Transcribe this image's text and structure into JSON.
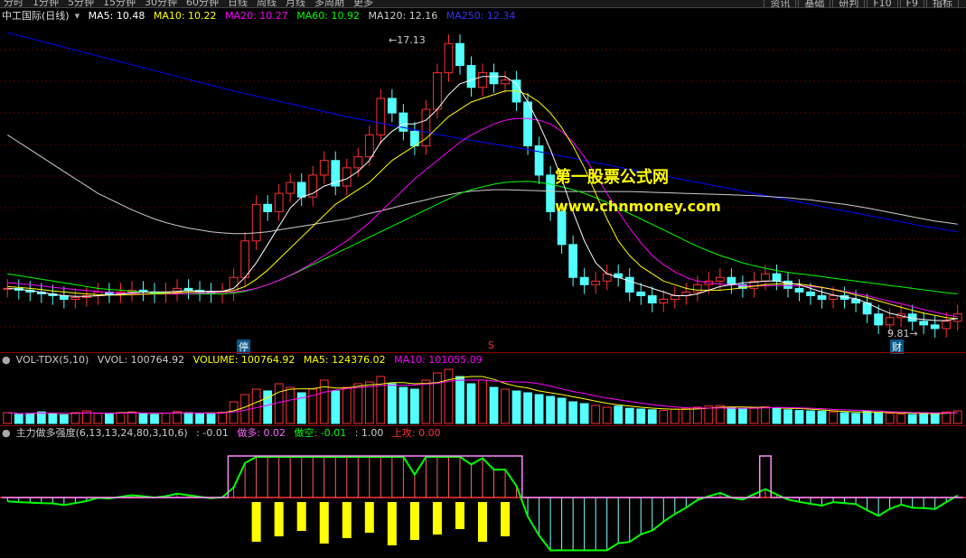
{
  "topbar": {
    "tabs": [
      "分时",
      "1分钟",
      "5分钟",
      "15分钟",
      "30分钟",
      "60分钟",
      "日线",
      "周线",
      "月线",
      "多周期",
      "更多"
    ],
    "right": [
      "资讯",
      "基础",
      "研判",
      "F10",
      "F9",
      "指标"
    ]
  },
  "main_header": {
    "title": "中工国际(日线)",
    "ma5": "MA5: 10.48",
    "ma10": "MA10: 10.22",
    "ma20": "MA20: 10.27",
    "ma60": "MA60: 10.92",
    "ma120": "MA120: 12.16",
    "ma250": "MA250: 12.34",
    "colors": {
      "ma5": "#ffffff",
      "ma10": "#ffff00",
      "ma20": "#ff00ff",
      "ma60": "#00ff00",
      "ma120": "#cccccc",
      "ma250": "#0000ff"
    }
  },
  "annotations": {
    "high": "17.13",
    "low": "9.81",
    "stop_marker": "停",
    "s_marker": "S",
    "fin_marker": "财"
  },
  "watermark": {
    "line1": "第一股票公式网",
    "line2": "www.chnmoney.com"
  },
  "vol_header": {
    "name": "VOL-TDX(5,10)",
    "vvol": "VVOL: 100764.92",
    "volume": "VOLUME: 100764.92",
    "ma5": "MA5: 124376.02",
    "ma10": "MA10: 101055.09"
  },
  "ind_header": {
    "name": "主力做多强度(6,13,13,24,80,3,10,6)",
    "v1": ": -0.01",
    "long": "做多: 0.02",
    "short": "做空: -0.01",
    "v4": ": 1.00",
    "attack": "上攻: 0.00"
  },
  "chart_data": {
    "type": "candlestick",
    "price_ylim": [
      9.0,
      17.5
    ],
    "price_path": [
      10.3,
      10.25,
      10.2,
      10.15,
      10.1,
      10.0,
      10.05,
      10.1,
      10.2,
      10.15,
      10.2,
      10.25,
      10.2,
      10.15,
      10.2,
      10.3,
      10.25,
      10.2,
      10.15,
      10.2,
      10.6,
      11.6,
      12.6,
      12.4,
      12.9,
      13.2,
      12.8,
      13.4,
      13.8,
      13.1,
      13.6,
      13.9,
      14.5,
      15.5,
      15.1,
      14.6,
      14.2,
      15.2,
      16.2,
      17.0,
      16.4,
      15.8,
      16.2,
      15.9,
      16.0,
      15.4,
      14.2,
      13.4,
      12.4,
      11.5,
      10.6,
      10.4,
      10.5,
      10.7,
      10.6,
      10.2,
      10.1,
      9.9,
      10.0,
      10.1,
      10.2,
      10.4,
      10.5,
      10.6,
      10.4,
      10.3,
      10.5,
      10.7,
      10.5,
      10.3,
      10.2,
      10.1,
      10.0,
      10.1,
      10.0,
      9.9,
      9.6,
      9.3,
      9.5,
      9.6,
      9.4,
      9.3,
      9.2,
      9.4,
      9.6
    ],
    "ma5": [
      10.3,
      10.28,
      10.24,
      10.19,
      10.14,
      10.1,
      10.08,
      10.08,
      10.1,
      10.12,
      10.14,
      10.18,
      10.2,
      10.2,
      10.2,
      10.22,
      10.24,
      10.22,
      10.22,
      10.22,
      10.3,
      10.6,
      11.0,
      11.5,
      12.0,
      12.5,
      12.8,
      12.9,
      13.1,
      13.2,
      13.3,
      13.5,
      13.8,
      14.3,
      14.6,
      14.8,
      14.8,
      14.9,
      15.2,
      15.6,
      15.9,
      16.0,
      16.1,
      16.1,
      16.1,
      15.9,
      15.4,
      14.8,
      14.1,
      13.3,
      12.4,
      11.6,
      11.0,
      10.7,
      10.6,
      10.5,
      10.4,
      10.3,
      10.2,
      10.1,
      10.1,
      10.15,
      10.25,
      10.35,
      10.4,
      10.45,
      10.47,
      10.5,
      10.5,
      10.45,
      10.4,
      10.3,
      10.2,
      10.12,
      10.06,
      10.02,
      9.9,
      9.75,
      9.62,
      9.55,
      9.48,
      9.45,
      9.42,
      9.42,
      9.48
    ],
    "ma10": [
      10.35,
      10.33,
      10.3,
      10.27,
      10.23,
      10.2,
      10.17,
      10.15,
      10.13,
      10.12,
      10.12,
      10.13,
      10.14,
      10.15,
      10.16,
      10.18,
      10.2,
      10.21,
      10.21,
      10.21,
      10.24,
      10.35,
      10.55,
      10.8,
      11.1,
      11.4,
      11.7,
      12.0,
      12.3,
      12.6,
      12.8,
      13.0,
      13.2,
      13.5,
      13.8,
      14.0,
      14.2,
      14.4,
      14.7,
      15.0,
      15.2,
      15.4,
      15.5,
      15.6,
      15.7,
      15.7,
      15.6,
      15.4,
      15.1,
      14.7,
      14.2,
      13.6,
      12.9,
      12.2,
      11.6,
      11.2,
      10.9,
      10.7,
      10.5,
      10.4,
      10.3,
      10.25,
      10.25,
      10.25,
      10.28,
      10.32,
      10.36,
      10.4,
      10.42,
      10.43,
      10.42,
      10.38,
      10.33,
      10.27,
      10.2,
      10.12,
      10.05,
      9.96,
      9.87,
      9.78,
      9.7,
      9.62,
      9.56,
      9.5,
      9.47
    ],
    "ma20": [
      10.45,
      10.43,
      10.4,
      10.37,
      10.33,
      10.3,
      10.27,
      10.24,
      10.21,
      10.19,
      10.17,
      10.16,
      10.15,
      10.15,
      10.15,
      10.15,
      10.16,
      10.17,
      10.18,
      10.19,
      10.2,
      10.24,
      10.3,
      10.4,
      10.52,
      10.66,
      10.82,
      11.0,
      11.2,
      11.4,
      11.6,
      11.85,
      12.1,
      12.4,
      12.7,
      13.0,
      13.3,
      13.55,
      13.8,
      14.05,
      14.3,
      14.5,
      14.65,
      14.8,
      14.9,
      14.95,
      14.95,
      14.9,
      14.8,
      14.6,
      14.3,
      13.9,
      13.4,
      12.9,
      12.4,
      11.95,
      11.55,
      11.2,
      10.95,
      10.75,
      10.6,
      10.5,
      10.45,
      10.42,
      10.4,
      10.38,
      10.37,
      10.37,
      10.38,
      10.38,
      10.37,
      10.35,
      10.32,
      10.28,
      10.22,
      10.16,
      10.1,
      10.02,
      9.95,
      9.88,
      9.8,
      9.72,
      9.65,
      9.58,
      9.52
    ],
    "ma60": [
      10.7,
      10.65,
      10.6,
      10.55,
      10.5,
      10.45,
      10.4,
      10.35,
      10.3,
      10.27,
      10.25,
      10.22,
      10.2,
      10.18,
      10.17,
      10.16,
      10.15,
      10.15,
      10.15,
      10.15,
      10.17,
      10.22,
      10.3,
      10.4,
      10.52,
      10.65,
      10.8,
      10.95,
      11.1,
      11.25,
      11.4,
      11.55,
      11.7,
      11.85,
      12.0,
      12.15,
      12.3,
      12.45,
      12.6,
      12.75,
      12.9,
      13.0,
      13.08,
      13.15,
      13.2,
      13.22,
      13.23,
      13.2,
      13.15,
      13.08,
      13.0,
      12.9,
      12.78,
      12.65,
      12.5,
      12.35,
      12.2,
      12.05,
      11.9,
      11.75,
      11.6,
      11.45,
      11.32,
      11.2,
      11.1,
      11.0,
      10.92,
      10.85,
      10.79,
      10.74,
      10.7,
      10.66,
      10.62,
      10.58,
      10.54,
      10.5,
      10.46,
      10.42,
      10.38,
      10.34,
      10.3,
      10.26,
      10.22,
      10.18,
      10.15
    ],
    "ma120": [
      14.5,
      14.3,
      14.1,
      13.9,
      13.7,
      13.5,
      13.3,
      13.1,
      12.9,
      12.75,
      12.6,
      12.45,
      12.32,
      12.2,
      12.1,
      12.02,
      11.95,
      11.9,
      11.85,
      11.82,
      11.8,
      11.8,
      11.82,
      11.85,
      11.9,
      11.95,
      12.0,
      12.05,
      12.1,
      12.15,
      12.2,
      12.28,
      12.35,
      12.42,
      12.5,
      12.58,
      12.65,
      12.72,
      12.8,
      12.86,
      12.92,
      12.96,
      12.98,
      13.0,
      13.0,
      12.99,
      12.98,
      12.97,
      12.96,
      12.95,
      12.95,
      12.95,
      12.95,
      12.95,
      12.95,
      12.95,
      12.94,
      12.93,
      12.92,
      12.91,
      12.9,
      12.89,
      12.88,
      12.87,
      12.86,
      12.85,
      12.84,
      12.82,
      12.8,
      12.78,
      12.75,
      12.72,
      12.68,
      12.64,
      12.6,
      12.55,
      12.5,
      12.44,
      12.38,
      12.32,
      12.26,
      12.2,
      12.14,
      12.1,
      12.06
    ],
    "ma250": [
      17.3,
      17.22,
      17.14,
      17.06,
      16.98,
      16.9,
      16.82,
      16.74,
      16.66,
      16.58,
      16.5,
      16.42,
      16.34,
      16.26,
      16.18,
      16.1,
      16.02,
      15.94,
      15.86,
      15.78,
      15.7,
      15.63,
      15.56,
      15.49,
      15.42,
      15.35,
      15.28,
      15.21,
      15.14,
      15.07,
      15.0,
      14.94,
      14.88,
      14.82,
      14.76,
      14.7,
      14.64,
      14.58,
      14.52,
      14.46,
      14.4,
      14.35,
      14.3,
      14.25,
      14.2,
      14.15,
      14.1,
      14.04,
      13.98,
      13.92,
      13.86,
      13.8,
      13.74,
      13.68,
      13.62,
      13.56,
      13.5,
      13.44,
      13.38,
      13.32,
      13.26,
      13.2,
      13.14,
      13.08,
      13.02,
      12.96,
      12.9,
      12.84,
      12.78,
      12.72,
      12.66,
      12.6,
      12.54,
      12.48,
      12.42,
      12.36,
      12.3,
      12.24,
      12.18,
      12.12,
      12.06,
      12.0,
      11.95,
      11.9,
      11.85
    ],
    "volume": [
      30,
      25,
      28,
      32,
      27,
      24,
      30,
      35,
      28,
      26,
      30,
      32,
      27,
      25,
      29,
      33,
      30,
      28,
      26,
      31,
      60,
      80,
      95,
      90,
      110,
      100,
      85,
      95,
      120,
      90,
      100,
      110,
      115,
      130,
      110,
      100,
      95,
      120,
      140,
      150,
      130,
      110,
      120,
      100,
      95,
      90,
      85,
      80,
      75,
      70,
      60,
      55,
      50,
      45,
      48,
      42,
      40,
      38,
      36,
      40,
      42,
      45,
      48,
      50,
      44,
      40,
      42,
      46,
      44,
      38,
      36,
      35,
      34,
      32,
      30,
      28,
      35,
      30,
      28,
      26,
      25,
      30,
      28,
      32,
      35
    ]
  }
}
